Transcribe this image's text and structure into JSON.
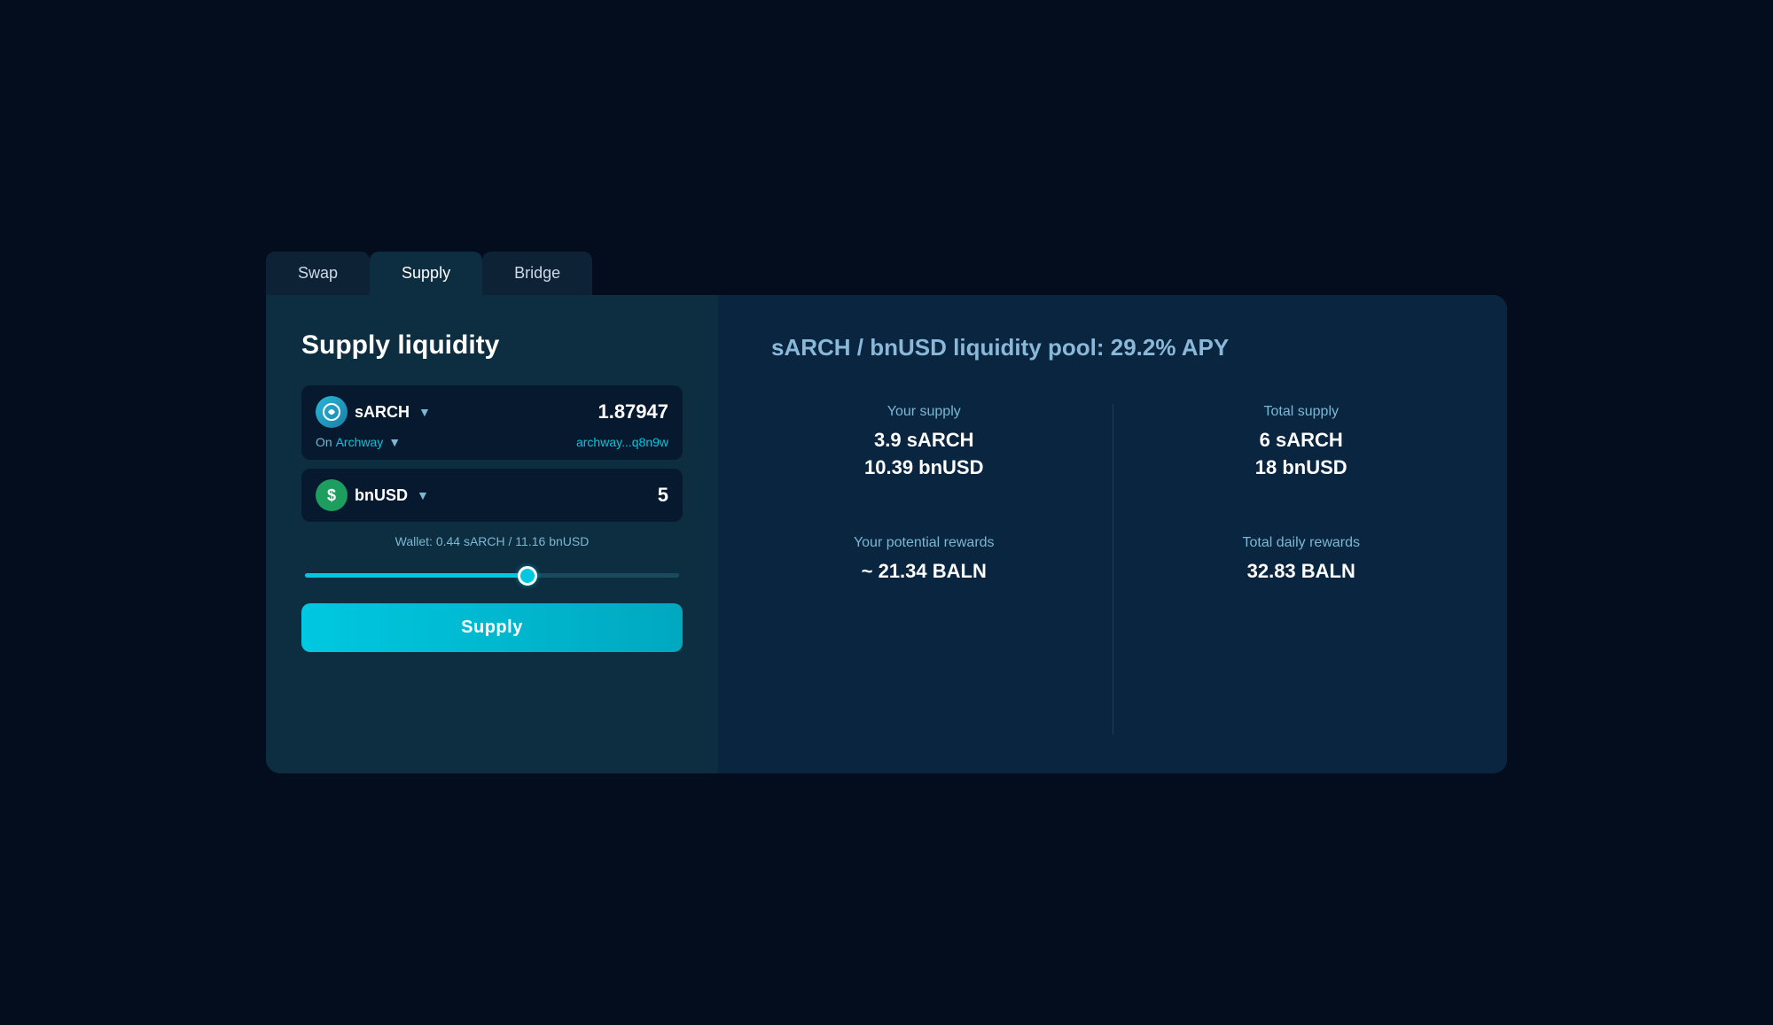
{
  "tabs": [
    {
      "id": "swap",
      "label": "Swap",
      "active": false
    },
    {
      "id": "supply",
      "label": "Supply",
      "active": true
    },
    {
      "id": "bridge",
      "label": "Bridge",
      "active": false
    }
  ],
  "left_panel": {
    "title": "Supply liquidity",
    "sarch_token": {
      "name": "sARCH",
      "amount": "1.87947",
      "network_label": "On",
      "network_name": "Archway",
      "wallet_address": "archway...q8n9w"
    },
    "bnusd_token": {
      "name": "bnUSD",
      "amount": "5"
    },
    "wallet_info": "Wallet: 0.44 sARCH / 11.16 bnUSD",
    "slider_value": 60,
    "supply_button_label": "Supply"
  },
  "right_panel": {
    "pool_title_prefix": "sARCH / bnUSD liquidity pool:",
    "pool_apy": "29.2% APY",
    "your_supply_label": "Your supply",
    "your_supply_sarch": "3.9 sARCH",
    "your_supply_bnusd": "10.39 bnUSD",
    "total_supply_label": "Total supply",
    "total_supply_sarch": "6 sARCH",
    "total_supply_bnusd": "18 bnUSD",
    "your_rewards_label": "Your potential rewards",
    "your_rewards_value": "~ 21.34 BALN",
    "total_rewards_label": "Total daily rewards",
    "total_rewards_value": "32.83 BALN"
  }
}
